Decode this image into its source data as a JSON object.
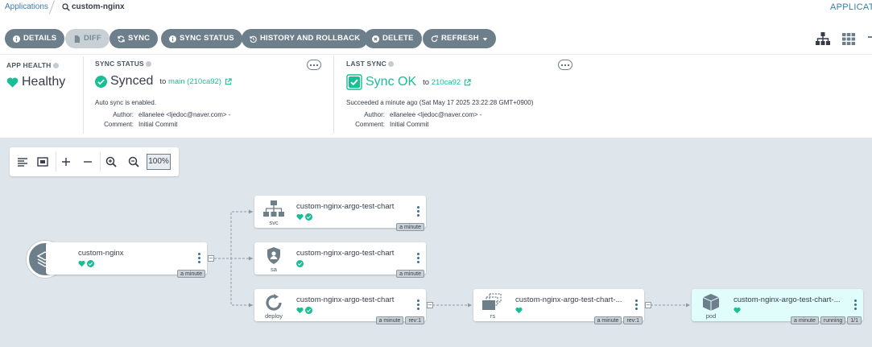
{
  "breadcrumb": {
    "root": "Applications",
    "current": "custom-nginx",
    "right_label": "APPLICAT"
  },
  "toolbar": {
    "details": "DETAILS",
    "diff": "DIFF",
    "sync": "SYNC",
    "sync_status": "SYNC STATUS",
    "history": "HISTORY AND ROLLBACK",
    "delete": "DELETE",
    "refresh": "REFRESH"
  },
  "app_health": {
    "title": "APP HEALTH",
    "value": "Healthy"
  },
  "sync_status": {
    "title": "SYNC STATUS",
    "value": "Synced",
    "to_prefix": "to",
    "target": "main (210ca92)",
    "auto_sync": "Auto sync is enabled.",
    "author_label": "Author:",
    "author": "ellanelee <ljedoc@naver.com> -",
    "comment_label": "Comment:",
    "comment": "Initial Commit"
  },
  "last_sync": {
    "title": "LAST SYNC",
    "value": "Sync OK",
    "to_prefix": "to",
    "target": "210ca92",
    "when": "Succeeded a minute ago (Sat May 17 2025 23:22:28 GMT+0900)",
    "author_label": "Author:",
    "author": "ellanelee <ljedoc@naver.com> -",
    "comment_label": "Comment:",
    "comment": "Initial Commit"
  },
  "graph": {
    "zoom": "100%",
    "nodes": {
      "app": {
        "name": "custom-nginx",
        "age": "a minute"
      },
      "svc": {
        "name": "custom-nginx-argo-test-chart",
        "kind": "svc",
        "age": "a minute"
      },
      "sa": {
        "name": "custom-nginx-argo-test-chart",
        "kind": "sa",
        "age": "a minute"
      },
      "deploy": {
        "name": "custom-nginx-argo-test-chart",
        "kind": "deploy",
        "age": "a minute",
        "rev": "rev:1"
      },
      "rs": {
        "name": "custom-nginx-argo-test-chart-...",
        "kind": "rs",
        "age": "a minute",
        "rev": "rev:1"
      },
      "pod": {
        "name": "custom-nginx-argo-test-chart-...",
        "kind": "pod",
        "age": "a minute",
        "state": "running",
        "ready": "1/1"
      }
    }
  },
  "colors": {
    "healthy": "#18be94",
    "button": "#6d7f8b",
    "link": "#3a7ca5",
    "graph_bg": "#dee6eb"
  }
}
